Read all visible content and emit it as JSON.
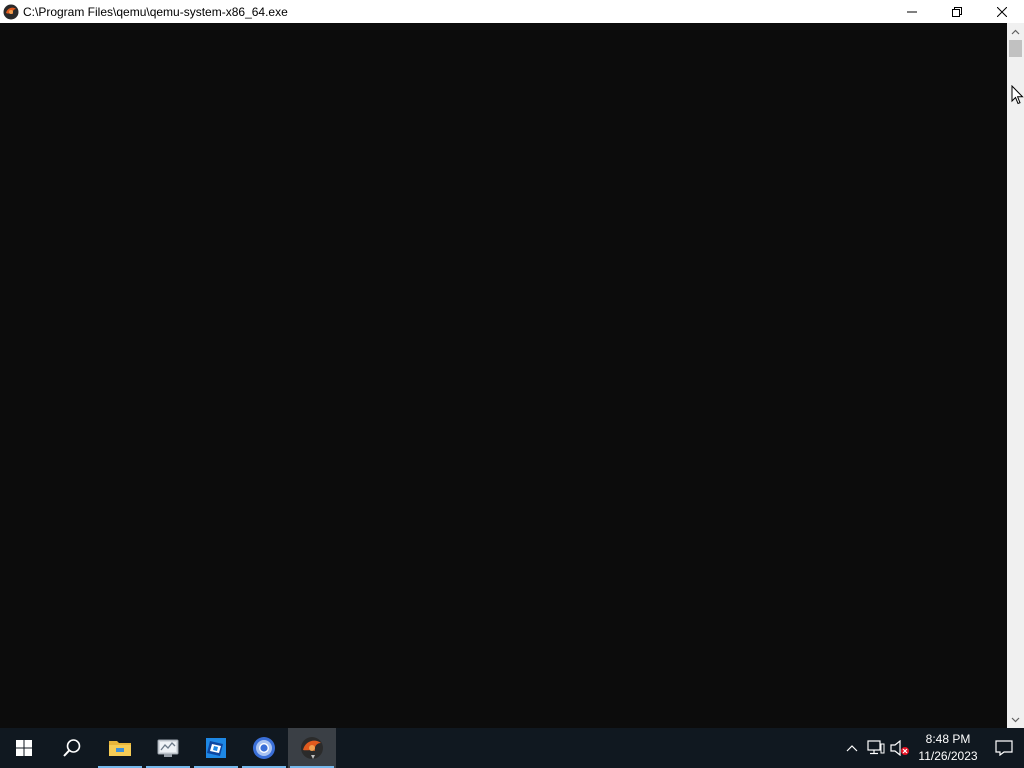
{
  "window": {
    "title": "C:\\Program Files\\qemu\\qemu-system-x86_64.exe",
    "app_icon": "qemu-icon",
    "controls": {
      "minimize_icon": "minimize-icon",
      "maximize_icon": "restore-icon",
      "close_icon": "close-icon"
    }
  },
  "console": {
    "background": "#0c0c0c",
    "content": ""
  },
  "taskbar": {
    "items": [
      {
        "name": "start-button",
        "icon": "windows-logo-icon"
      },
      {
        "name": "search-button",
        "icon": "search-icon"
      },
      {
        "name": "file-explorer-button",
        "icon": "folder-icon",
        "running": true
      },
      {
        "name": "server-manager-button",
        "icon": "server-manager-icon",
        "running": true
      },
      {
        "name": "roblox-studio-button",
        "icon": "roblox-studio-icon",
        "running": true
      },
      {
        "name": "chrome-button",
        "icon": "chrome-icon",
        "running": true
      },
      {
        "name": "qemu-button",
        "icon": "qemu-icon",
        "running": true,
        "active": true
      }
    ],
    "tray": {
      "overflow_icon": "chevron-up-icon",
      "network_icon": "network-icon",
      "volume_icon": "volume-muted-icon",
      "time": "8:48 PM",
      "date": "11/26/2023",
      "notification_icon": "action-center-icon"
    }
  },
  "colors": {
    "console_bg": "#0c0c0c",
    "taskbar_bg": "#101820",
    "accent": "#76b9ed"
  }
}
